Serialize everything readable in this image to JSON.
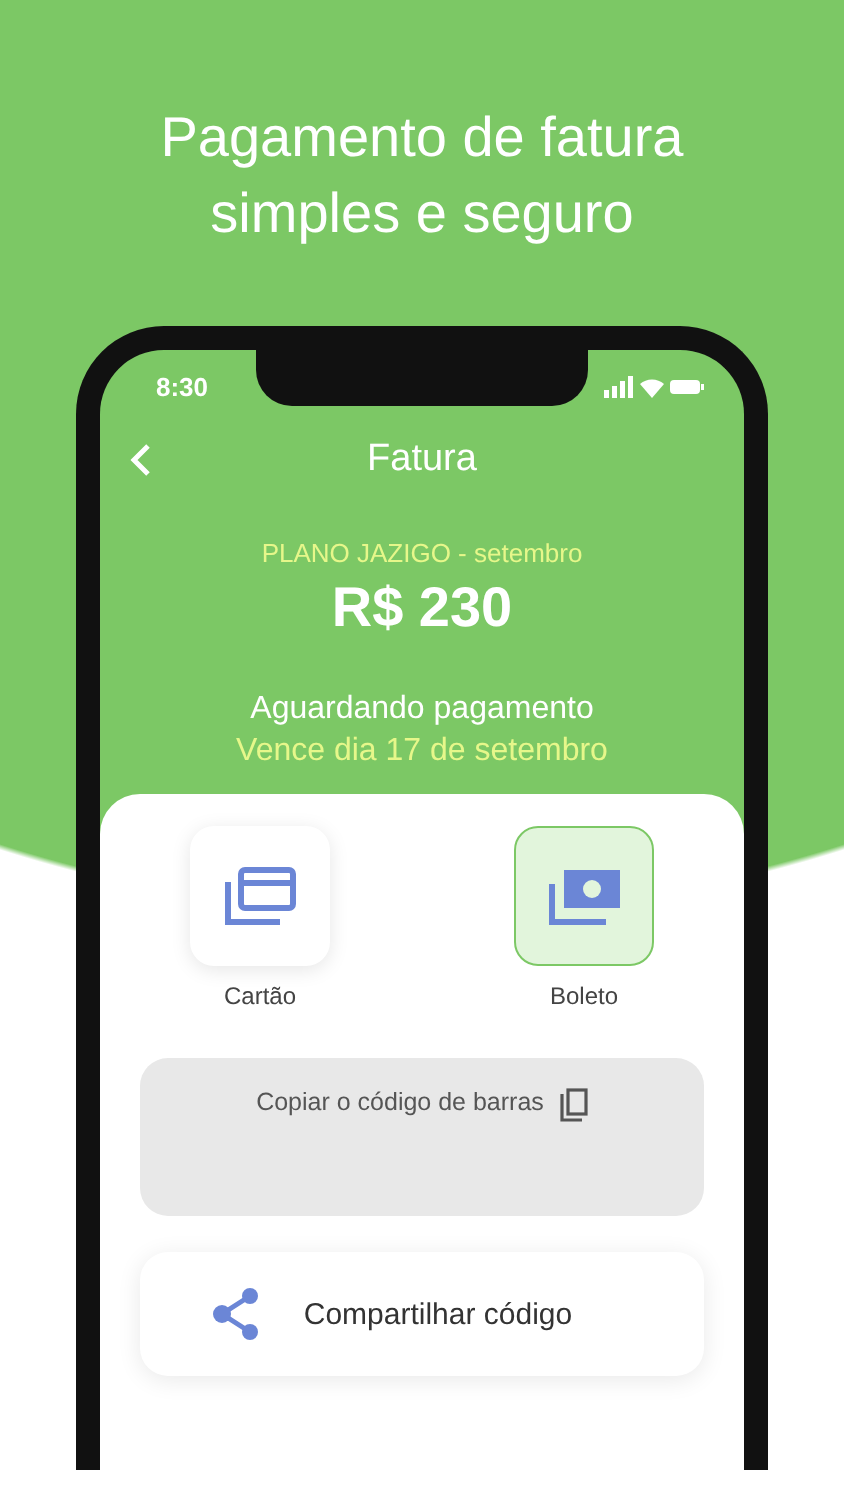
{
  "headline": "Pagamento de fatura simples e seguro",
  "status_bar": {
    "time": "8:30"
  },
  "header": {
    "title": "Fatura"
  },
  "invoice": {
    "plan": "PLANO JAZIGO - setembro",
    "amount": "R$ 230",
    "status": "Aguardando pagamento",
    "due": "Vence dia 17 de setembro"
  },
  "payment_methods": [
    {
      "kind": "card",
      "label": "Cartão",
      "selected": false
    },
    {
      "kind": "cash",
      "label": "Boleto",
      "selected": true
    }
  ],
  "copy_barcode": {
    "label": "Copiar o código de barras"
  },
  "share_button": {
    "label": "Compartilhar código"
  }
}
